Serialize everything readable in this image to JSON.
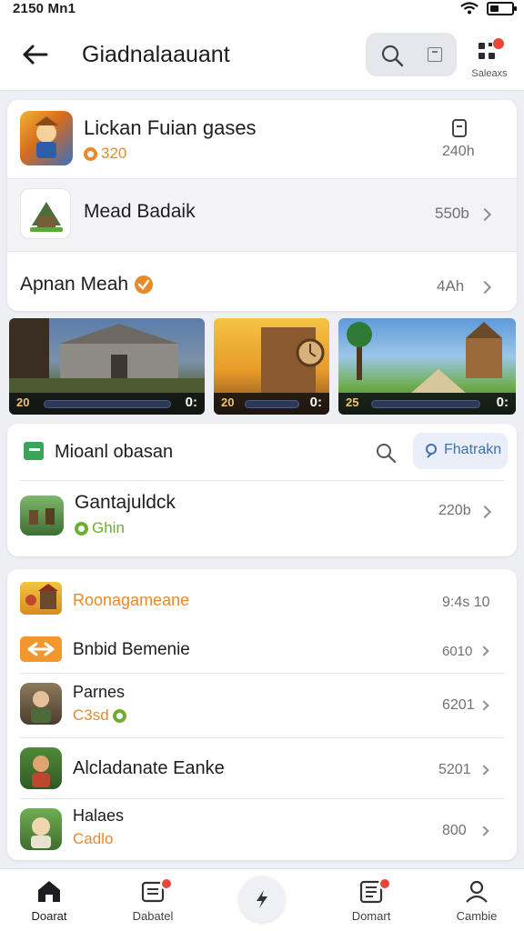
{
  "status_bar": {
    "time": "2150 Mn1"
  },
  "header": {
    "title": "Giadnalaauant",
    "grid_caption": "Saleaxs"
  },
  "card1": {
    "rows": [
      {
        "title": "Lickan Fuian gases",
        "subtitle": "320",
        "meta": "240h"
      },
      {
        "title": "Mead Badaik",
        "meta": "550b"
      },
      {
        "title": "Apnan Meah",
        "meta": "4Ah"
      }
    ]
  },
  "thumbnails": [
    {
      "left": "20",
      "right": "0:"
    },
    {
      "left": "20",
      "right": "0:"
    },
    {
      "left": "25",
      "right": "0:"
    }
  ],
  "card2": {
    "section_title": "Mioanl obasan",
    "action_label": "Fhatrakn",
    "row": {
      "title": "Gantajuldck",
      "subtitle": "Ghin",
      "meta": "220b"
    }
  },
  "card3": {
    "rows": [
      {
        "title": "Roonagameane",
        "meta": "9:4s 10"
      },
      {
        "title": "Bnbid Bemenie",
        "meta": "6010"
      },
      {
        "title": "Parnes",
        "subtitle": "C3sd",
        "meta": "6201"
      },
      {
        "title": "Alcladanate Eanke",
        "meta": "5201"
      },
      {
        "title": "Halaes",
        "subtitle": "Cadlo",
        "meta": "800"
      }
    ]
  },
  "nav": {
    "items": [
      {
        "label": "Doarat"
      },
      {
        "label": "Dabatel"
      },
      {
        "label": ""
      },
      {
        "label": "Domart"
      },
      {
        "label": "Cambie"
      }
    ]
  },
  "colors": {
    "accent_orange": "#e88a2a",
    "accent_green": "#6cae2f",
    "badge_red": "#e8463a",
    "accent_blue": "#3f6fb5"
  }
}
